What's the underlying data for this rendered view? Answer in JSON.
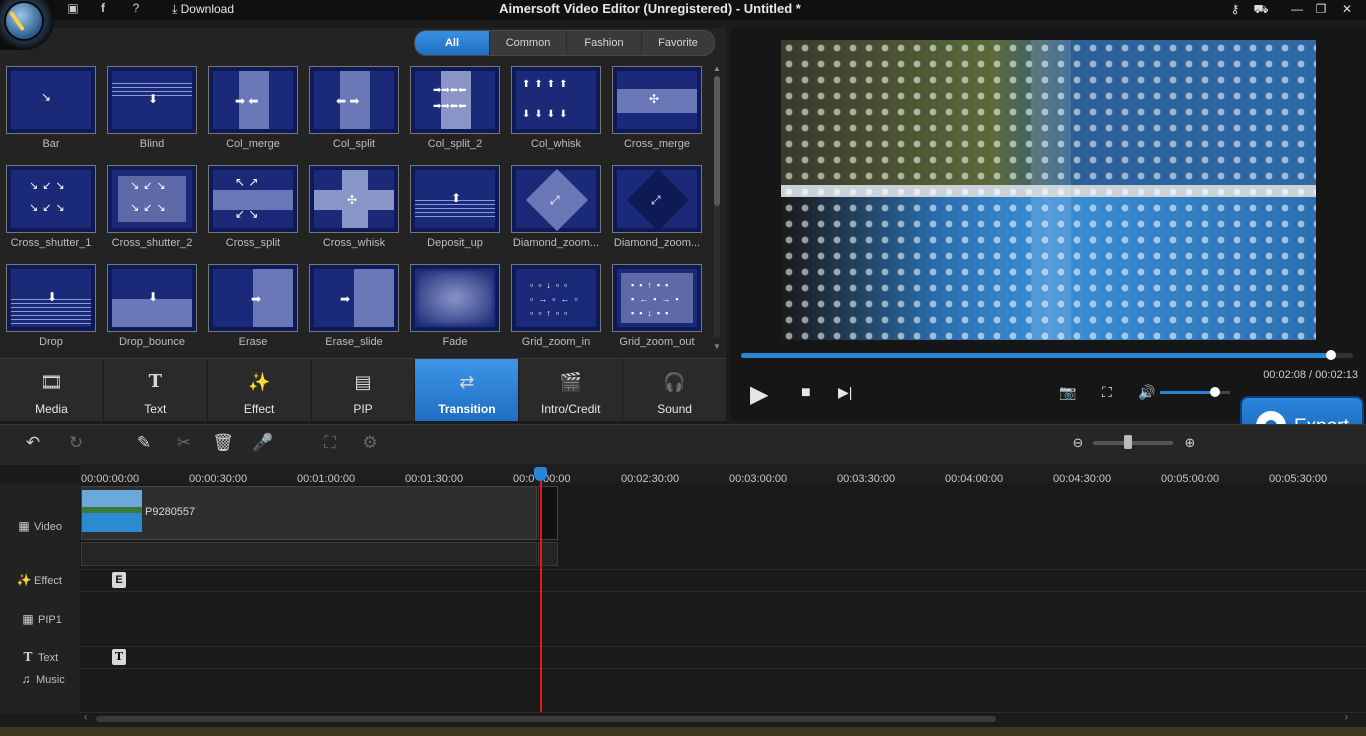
{
  "window": {
    "title": "Aimersoft Video Editor (Unregistered) - Untitled *",
    "download_label": "Download"
  },
  "filter_tabs": [
    {
      "label": "All",
      "active": true
    },
    {
      "label": "Common"
    },
    {
      "label": "Fashion"
    },
    {
      "label": "Favorite"
    }
  ],
  "transitions": [
    {
      "label": "Bar"
    },
    {
      "label": "Blind"
    },
    {
      "label": "Col_merge"
    },
    {
      "label": "Col_split"
    },
    {
      "label": "Col_split_2"
    },
    {
      "label": "Col_whisk"
    },
    {
      "label": "Cross_merge"
    },
    {
      "label": "Cross_shutter_1"
    },
    {
      "label": "Cross_shutter_2"
    },
    {
      "label": "Cross_split"
    },
    {
      "label": "Cross_whisk"
    },
    {
      "label": "Deposit_up"
    },
    {
      "label": "Diamond_zoom..."
    },
    {
      "label": "Diamond_zoom..."
    },
    {
      "label": "Drop"
    },
    {
      "label": "Drop_bounce"
    },
    {
      "label": "Erase"
    },
    {
      "label": "Erase_slide"
    },
    {
      "label": "Fade"
    },
    {
      "label": "Grid_zoom_in"
    },
    {
      "label": "Grid_zoom_out"
    }
  ],
  "categories": [
    {
      "label": "Media",
      "icon": "film-icon"
    },
    {
      "label": "Text",
      "icon": "text-icon"
    },
    {
      "label": "Effect",
      "icon": "magic-wand-icon"
    },
    {
      "label": "PIP",
      "icon": "pip-icon"
    },
    {
      "label": "Transition",
      "icon": "transition-icon",
      "active": true
    },
    {
      "label": "Intro/Credit",
      "icon": "clapper-icon"
    },
    {
      "label": "Sound",
      "icon": "headphones-icon"
    }
  ],
  "preview": {
    "time": "00:02:08 / 00:02:13",
    "progress": 0.964,
    "volume": 0.78
  },
  "export_label": "Export",
  "ruler": [
    "00:00:00:00",
    "00:00:30:00",
    "00:01:00:00",
    "00:01:30:00",
    "00:0",
    "00:00",
    "00:02:30:00",
    "00:03:00:00",
    "00:03:30:00",
    "00:04:00:00",
    "00:04:30:00",
    "00:05:00:00",
    "00:05:30:00"
  ],
  "tracks": {
    "video": "Video",
    "effect": "Effect",
    "pip": "PIP1",
    "text": "Text",
    "music": "Music"
  },
  "clip": {
    "name": "P9280557"
  },
  "markers": {
    "effect": "E",
    "text": "T"
  }
}
